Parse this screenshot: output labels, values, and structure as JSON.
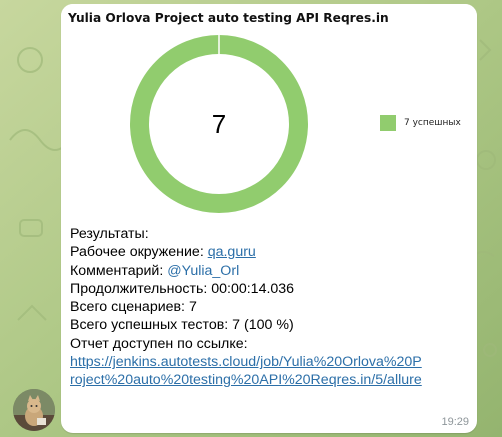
{
  "message": {
    "chart": {
      "title": "Yulia Orlova Project auto testing API Reqres.in",
      "center_value": "7",
      "legend_label": "7 успешных",
      "colors": {
        "success": "#91cc6e"
      }
    },
    "report": {
      "heading": "Результаты:",
      "env_label": "Рабочее окружение: ",
      "env_link": "qa.guru",
      "comment_label": "Комментарий: ",
      "comment_mention": "@Yulia_Orl",
      "duration": "Продолжительность: 00:00:14.036",
      "scenarios": "Всего сценариев: 7",
      "passed": "Всего успешных тестов: 7 (100 %)",
      "link_label": "Отчет доступен по ссылке:",
      "url_line_1": "https://jenkins.autotests.cloud/job/Yulia%20Orlova%20P",
      "url_line_2": "roject%20auto%20testing%20API%20Reqres.in/5/allure"
    },
    "time": "19:29"
  },
  "chart_data": {
    "type": "pie",
    "title": "Yulia Orlova Project auto testing API Reqres.in",
    "categories": [
      "7 успешных"
    ],
    "values": [
      7
    ],
    "total": 7,
    "colors": [
      "#91cc6e"
    ],
    "legend": "right"
  }
}
